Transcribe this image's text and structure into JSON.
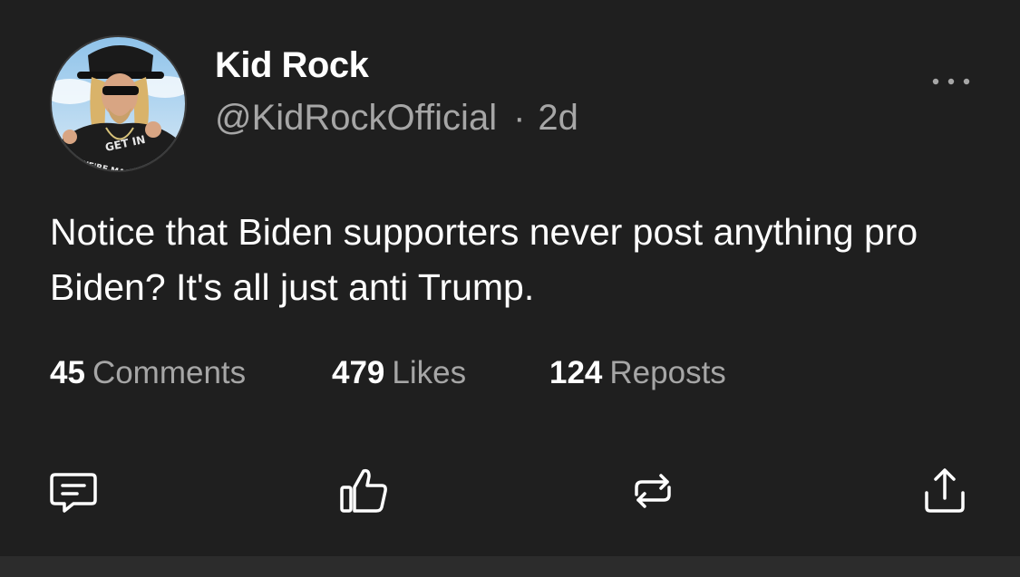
{
  "post": {
    "display_name": "Kid Rock",
    "handle": "@KidRockOfficial",
    "separator": "·",
    "time_ago": "2d",
    "text": "Notice that Biden supporters never post anything pro Biden? It's all just anti Trump.",
    "avatar": {
      "shirt_line1": "GET IN",
      "shirt_line2": "WE'RE MAKING"
    }
  },
  "stats": {
    "comments": {
      "count": "45",
      "label": "Comments"
    },
    "likes": {
      "count": "479",
      "label": "Likes"
    },
    "reposts": {
      "count": "124",
      "label": "Reposts"
    }
  },
  "icons": {
    "more": "more-horizontal-icon",
    "comment": "comment-icon",
    "like": "thumbs-up-icon",
    "repost": "repost-icon",
    "share": "share-icon"
  },
  "colors": {
    "background": "#1f1f1f",
    "primary_text": "#ffffff",
    "secondary_text": "#a6a6a6",
    "bottom_strip": "#2c2c2c"
  }
}
